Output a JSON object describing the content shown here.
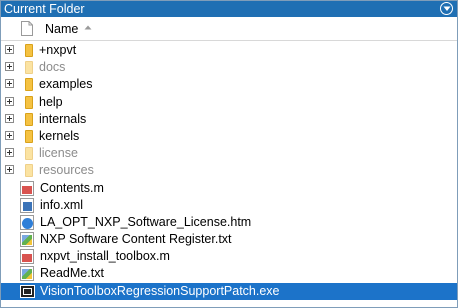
{
  "panel": {
    "title": "Current Folder",
    "column_header": "Name",
    "sort": "ascending",
    "accent_color": "#1f6fb3",
    "selection_color": "#1c73c9"
  },
  "items": [
    {
      "name": "+nxpvt",
      "type": "folder",
      "expandable": true,
      "dim": false,
      "selected": false
    },
    {
      "name": "docs",
      "type": "folder",
      "expandable": true,
      "dim": true,
      "selected": false
    },
    {
      "name": "examples",
      "type": "folder",
      "expandable": true,
      "dim": false,
      "selected": false
    },
    {
      "name": "help",
      "type": "folder",
      "expandable": true,
      "dim": false,
      "selected": false
    },
    {
      "name": "internals",
      "type": "folder",
      "expandable": true,
      "dim": false,
      "selected": false
    },
    {
      "name": "kernels",
      "type": "folder",
      "expandable": true,
      "dim": false,
      "selected": false
    },
    {
      "name": "license",
      "type": "folder",
      "expandable": true,
      "dim": true,
      "selected": false
    },
    {
      "name": "resources",
      "type": "folder",
      "expandable": true,
      "dim": true,
      "selected": false
    },
    {
      "name": "Contents.m",
      "type": "m-file",
      "expandable": false,
      "dim": false,
      "selected": false
    },
    {
      "name": "info.xml",
      "type": "xml-file",
      "expandable": false,
      "dim": false,
      "selected": false
    },
    {
      "name": "LA_OPT_NXP_Software_License.htm",
      "type": "htm-file",
      "expandable": false,
      "dim": false,
      "selected": false
    },
    {
      "name": "NXP Software Content Register.txt",
      "type": "txt-file",
      "expandable": false,
      "dim": false,
      "selected": false
    },
    {
      "name": "nxpvt_install_toolbox.m",
      "type": "m-file",
      "expandable": false,
      "dim": false,
      "selected": false
    },
    {
      "name": "ReadMe.txt",
      "type": "txt-file",
      "expandable": false,
      "dim": false,
      "selected": false
    },
    {
      "name": "VisionToolboxRegressionSupportPatch.exe",
      "type": "exe-file",
      "expandable": false,
      "dim": false,
      "selected": true
    }
  ]
}
